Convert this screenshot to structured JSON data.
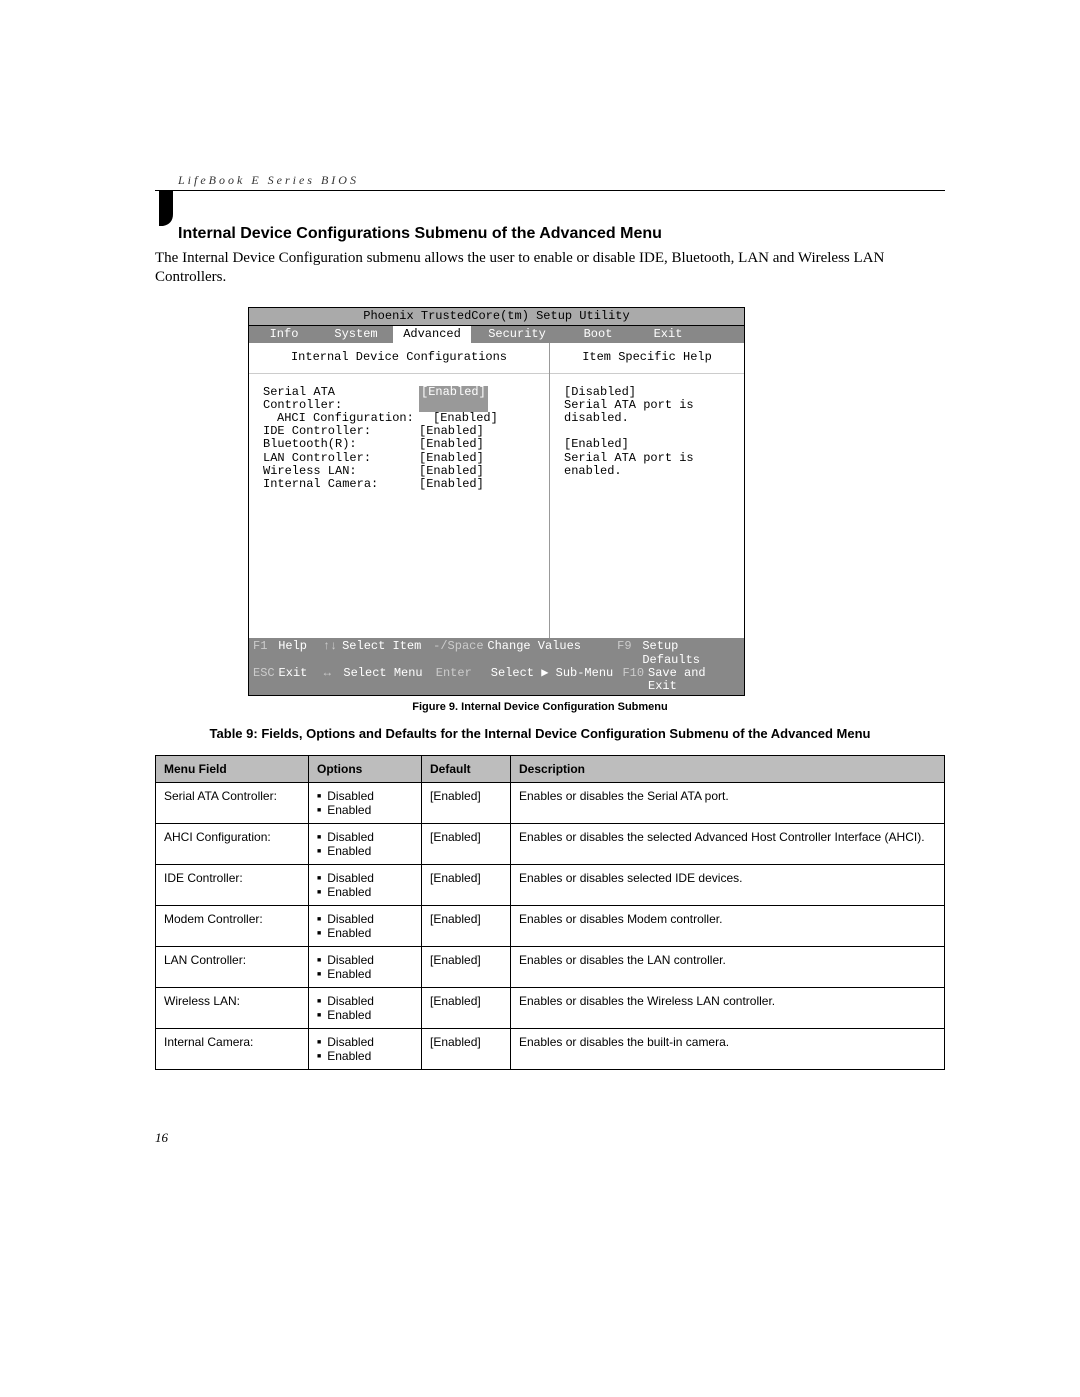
{
  "header": {
    "title": "LifeBook E Series BIOS"
  },
  "section": {
    "heading": "Internal Device Configurations Submenu of the Advanced Menu",
    "para": "The Internal Device Configuration submenu allows the user to enable or disable IDE, Bluetooth, LAN and Wireless LAN Controllers."
  },
  "bios": {
    "title": "Phoenix TrustedCore(tm) Setup Utility",
    "tabs": {
      "info": "Info",
      "system": "System",
      "advanced": "Advanced",
      "security": "Security",
      "boot": "Boot",
      "exit": "Exit"
    },
    "submenu_title": "Internal Device Configurations",
    "help_title": "Item Specific Help",
    "items": [
      {
        "label": "Serial ATA Controller:",
        "value": "[Enabled]",
        "selected": true,
        "indent": false
      },
      {
        "label": "AHCI Configuration:",
        "value": "[Enabled]",
        "selected": false,
        "indent": true
      },
      {
        "label": "IDE Controller:",
        "value": "[Enabled]",
        "selected": false,
        "indent": false
      },
      {
        "label": "Bluetooth(R):",
        "value": "[Enabled]",
        "selected": false,
        "indent": false
      },
      {
        "label": "LAN Controller:",
        "value": "[Enabled]",
        "selected": false,
        "indent": false
      },
      {
        "label": "Wireless LAN:",
        "value": "[Enabled]",
        "selected": false,
        "indent": false
      },
      {
        "label": "Internal Camera:",
        "value": "[Enabled]",
        "selected": false,
        "indent": false
      }
    ],
    "help_lines": [
      "[Disabled]",
      "Serial ATA port is",
      "disabled.",
      "",
      "[Enabled]",
      "Serial ATA port is",
      "enabled."
    ],
    "foot": {
      "r1": {
        "k1": "F1",
        "v1": "Help",
        "k2": "↑↓",
        "v2": "Select Item",
        "k3": "-/Space",
        "v3": "Change Values",
        "k4": "F9",
        "v4": "Setup Defaults"
      },
      "r2": {
        "k1": "ESC",
        "v1": "Exit",
        "k2": "↔",
        "v2": "Select Menu",
        "k3": "Enter",
        "v3": "Select ▶ Sub-Menu",
        "k4": "F10",
        "v4": "Save and Exit"
      }
    }
  },
  "figure_caption": "Figure 9.  Internal Device Configuration Submenu",
  "table_caption": "Table 9: Fields, Options and Defaults for the Internal Device Configuration Submenu of the Advanced Menu",
  "table": {
    "headers": {
      "menu": "Menu Field",
      "options": "Options",
      "def": "Default",
      "desc": "Description"
    },
    "rows": [
      {
        "menu": "Serial ATA Controller:",
        "indent": false,
        "options": [
          "Disabled",
          "Enabled"
        ],
        "def": "[Enabled]",
        "desc": "Enables or disables the Serial ATA port."
      },
      {
        "menu": "AHCI Configuration:",
        "indent": true,
        "options": [
          "Disabled",
          "Enabled"
        ],
        "def": "[Enabled]",
        "desc": "Enables or disables the selected Advanced Host Controller Interface (AHCI)."
      },
      {
        "menu": "IDE Controller:",
        "indent": false,
        "options": [
          "Disabled",
          "Enabled"
        ],
        "def": "[Enabled]",
        "desc": "Enables or disables selected IDE devices."
      },
      {
        "menu": "Modem Controller:",
        "indent": false,
        "options": [
          "Disabled",
          "Enabled"
        ],
        "def": "[Enabled]",
        "desc": "Enables or disables Modem controller."
      },
      {
        "menu": "LAN Controller:",
        "indent": false,
        "options": [
          "Disabled",
          "Enabled"
        ],
        "def": "[Enabled]",
        "desc": "Enables or disables the LAN controller."
      },
      {
        "menu": "Wireless LAN:",
        "indent": false,
        "options": [
          "Disabled",
          "Enabled"
        ],
        "def": "[Enabled]",
        "desc": "Enables or disables the Wireless LAN controller."
      },
      {
        "menu": "Internal Camera:",
        "indent": false,
        "options": [
          "Disabled",
          "Enabled"
        ],
        "def": "[Enabled]",
        "desc": "Enables or disables the built-in camera."
      }
    ]
  },
  "page_number": "16"
}
